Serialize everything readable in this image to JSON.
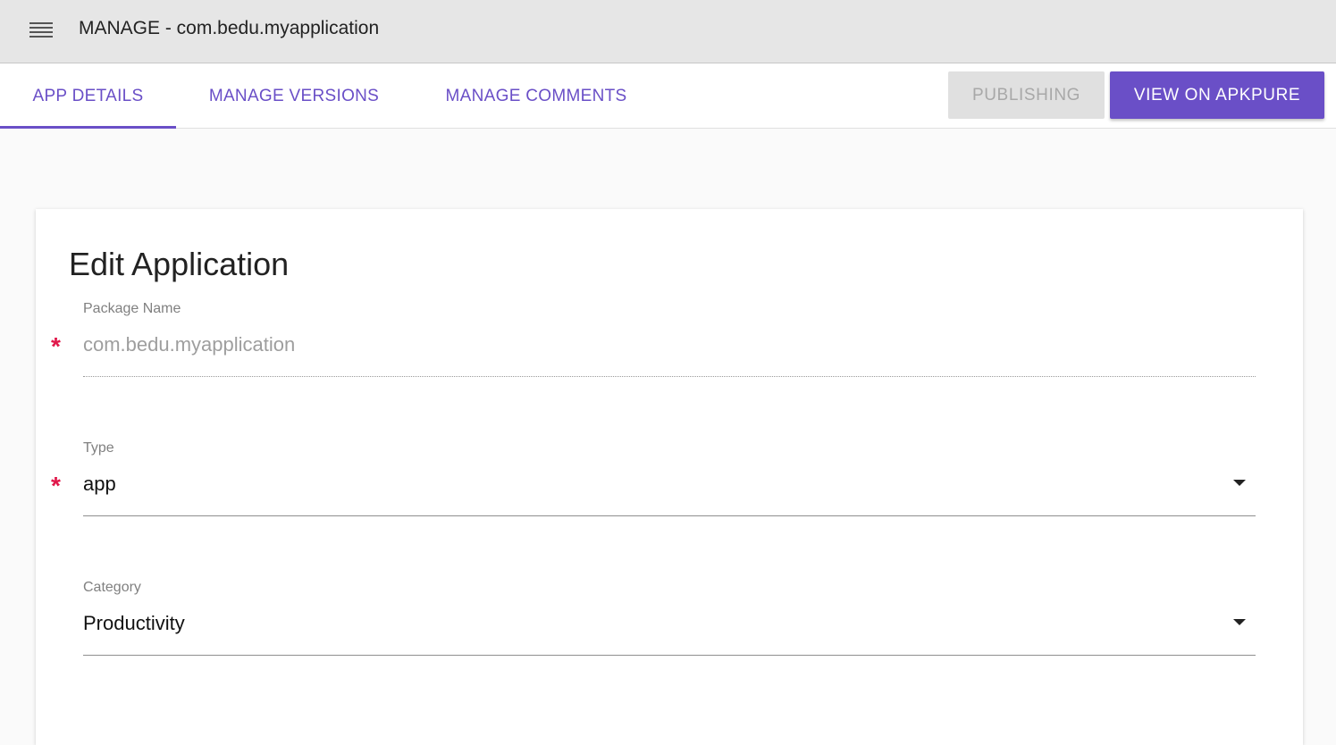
{
  "appbar": {
    "menu_icon": "hamburger-menu-icon",
    "title": "MANAGE - com.bedu.myapplication"
  },
  "tabs": [
    {
      "label": "APP DETAILS",
      "active": true
    },
    {
      "label": "MANAGE VERSIONS",
      "active": false
    },
    {
      "label": "MANAGE COMMENTS",
      "active": false
    }
  ],
  "actions": {
    "publishing_label": "PUBLISHING",
    "publishing_disabled": true,
    "view_label": "VIEW ON APKPURE"
  },
  "form": {
    "title": "Edit Application",
    "package_name": {
      "label": "Package Name",
      "value": "com.bedu.myapplication",
      "required": true,
      "disabled": true
    },
    "type": {
      "label": "Type",
      "value": "app",
      "required": true,
      "icon": "dropdown-arrow-icon"
    },
    "category": {
      "label": "Category",
      "value": "Productivity",
      "required": false,
      "icon": "dropdown-arrow-icon"
    },
    "required_mark": "*"
  },
  "colors": {
    "accent": "#6a4fc7",
    "required": "#e0184a",
    "appbar_bg": "#e6e6e6"
  }
}
